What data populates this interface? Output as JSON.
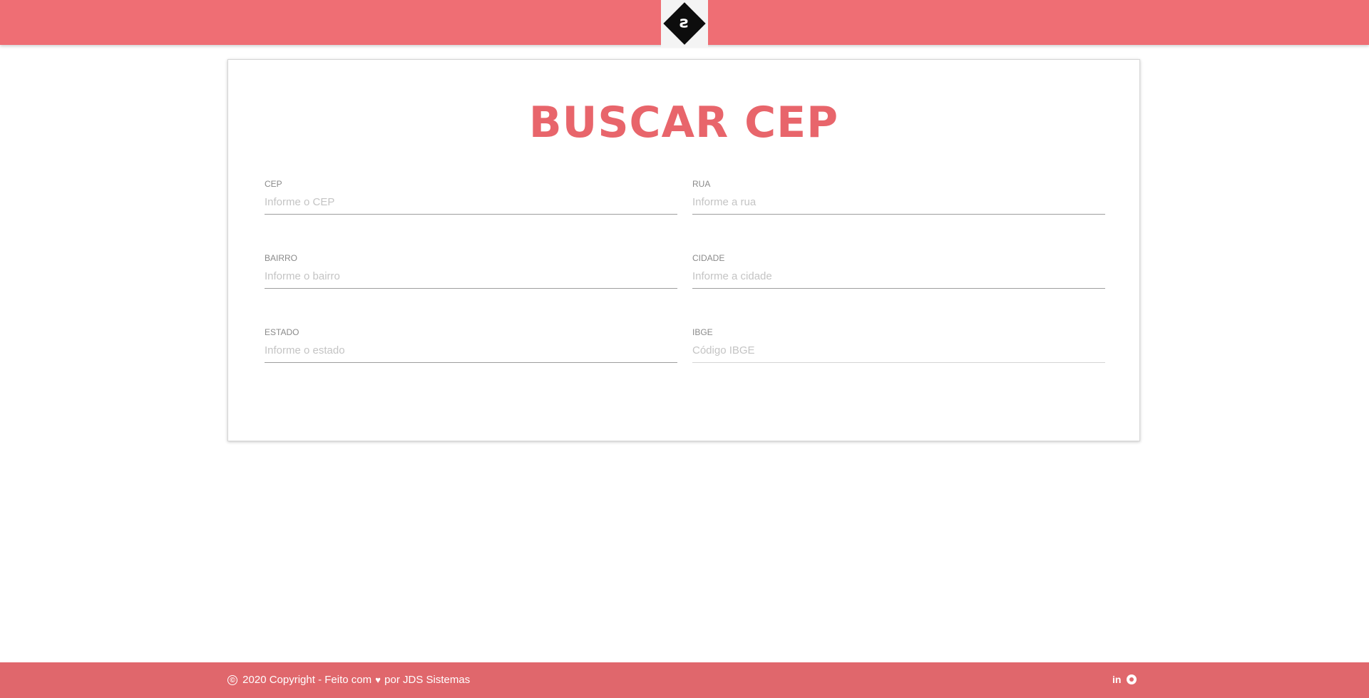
{
  "header": {
    "logo_glyph": "ƨ"
  },
  "form": {
    "title": "BUSCAR CEP",
    "fields": [
      {
        "label": "CEP",
        "placeholder": "Informe o CEP",
        "value": ""
      },
      {
        "label": "RUA",
        "placeholder": "Informe a rua",
        "value": ""
      },
      {
        "label": "BAIRRO",
        "placeholder": "Informe o bairro",
        "value": ""
      },
      {
        "label": "CIDADE",
        "placeholder": "Informe a cidade",
        "value": ""
      },
      {
        "label": "ESTADO",
        "placeholder": "Informe o estado",
        "value": ""
      },
      {
        "label": "IBGE",
        "placeholder": "Código IBGE",
        "value": ""
      }
    ]
  },
  "footer": {
    "copyright_symbol": "©",
    "text_before": " 2020 Copyright - Feito com ",
    "heart": "♥",
    "text_after": " por JDS Sistemas",
    "linkedin_label": "in"
  },
  "colors": {
    "brand": "#ef6e74",
    "title": "#e8656b",
    "footer": "#e0676c"
  },
  "icons": [
    "logo-icon",
    "copyright-icon",
    "heart-icon",
    "linkedin-icon",
    "github-icon"
  ]
}
